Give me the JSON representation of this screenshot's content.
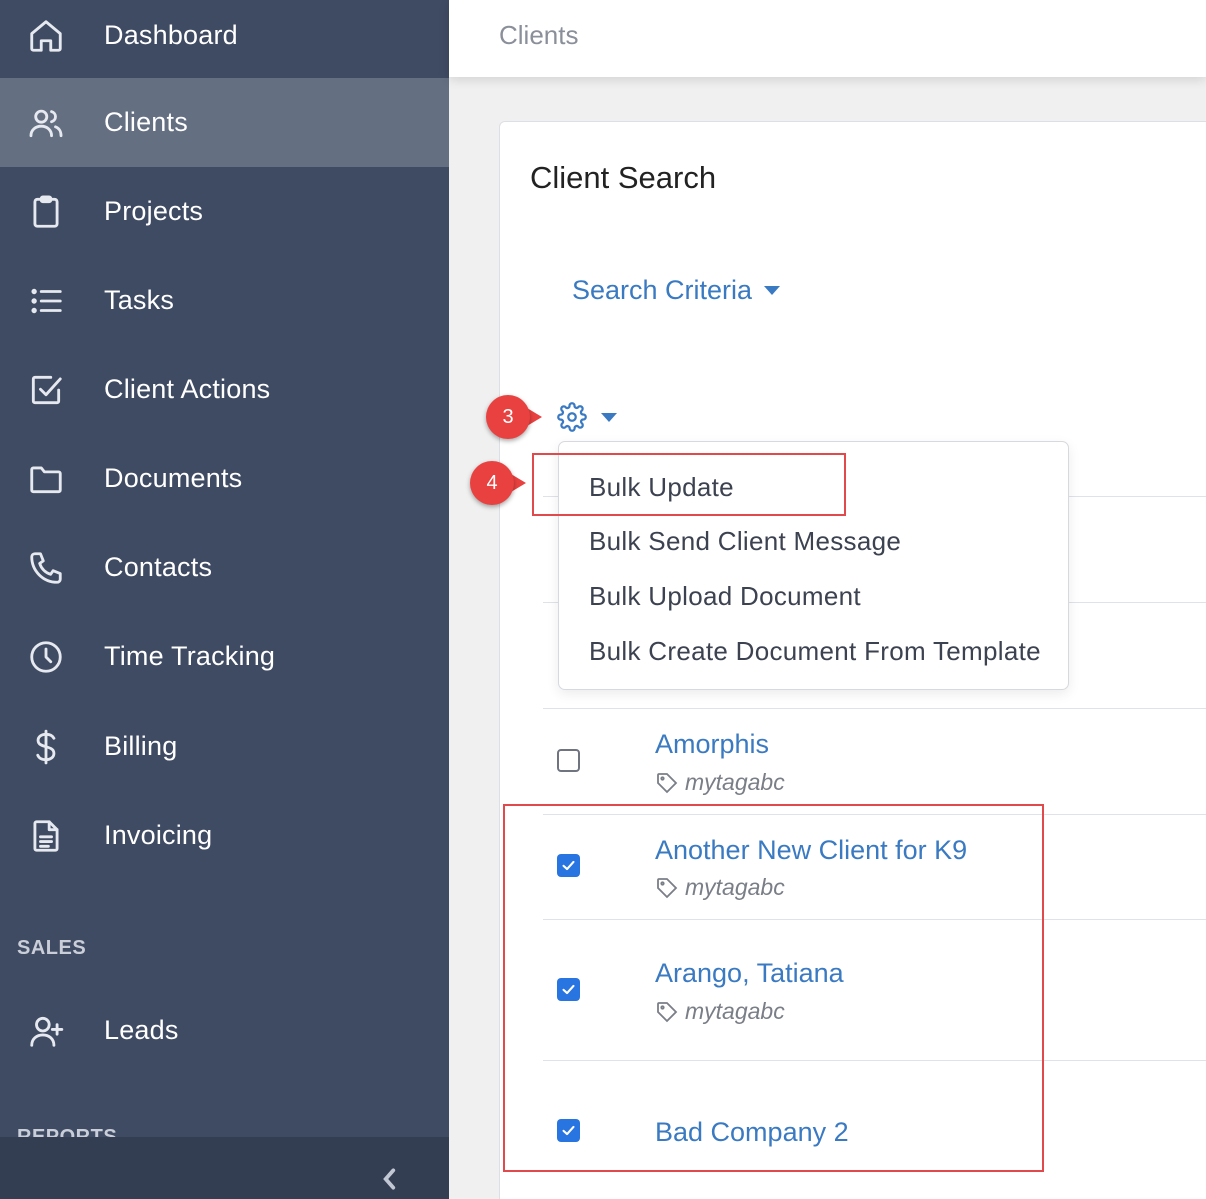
{
  "sidebar": {
    "items": [
      {
        "label": "Dashboard",
        "icon": "home-icon"
      },
      {
        "label": "Clients",
        "icon": "users-icon",
        "active": true
      },
      {
        "label": "Projects",
        "icon": "clipboard-icon"
      },
      {
        "label": "Tasks",
        "icon": "list-icon"
      },
      {
        "label": "Client Actions",
        "icon": "checkbox-icon"
      },
      {
        "label": "Documents",
        "icon": "folder-icon"
      },
      {
        "label": "Contacts",
        "icon": "phone-icon"
      },
      {
        "label": "Time Tracking",
        "icon": "clock-icon"
      },
      {
        "label": "Billing",
        "icon": "dollar-icon"
      },
      {
        "label": "Invoicing",
        "icon": "document-icon"
      }
    ],
    "sales_section": "SALES",
    "sales_items": [
      {
        "label": "Leads",
        "icon": "user-plus-icon"
      }
    ],
    "reports_section": "REPORTS"
  },
  "header": {
    "title": "Clients"
  },
  "card": {
    "title": "Client Search",
    "search_criteria": "Search Criteria"
  },
  "dropdown": {
    "items": [
      "Bulk Update",
      "Bulk Send Client Message",
      "Bulk Upload Document",
      "Bulk Create Document From Template"
    ]
  },
  "clients": [
    {
      "name": "Amorphis",
      "tag": "mytagabc",
      "checked": false
    },
    {
      "name": "Another New Client for K9",
      "tag": "mytagabc",
      "checked": true
    },
    {
      "name": "Arango, Tatiana",
      "tag": "mytagabc",
      "checked": true
    },
    {
      "name": "Bad Company 2",
      "tag": "",
      "checked": true
    }
  ],
  "callouts": {
    "step3": "3",
    "step4": "4"
  },
  "colors": {
    "sidebar_bg": "#3f4b63",
    "sidebar_active": "#646f82",
    "link_blue": "#3a7ac2",
    "checkbox_blue": "#2874e0",
    "callout_red": "#e8413f"
  }
}
